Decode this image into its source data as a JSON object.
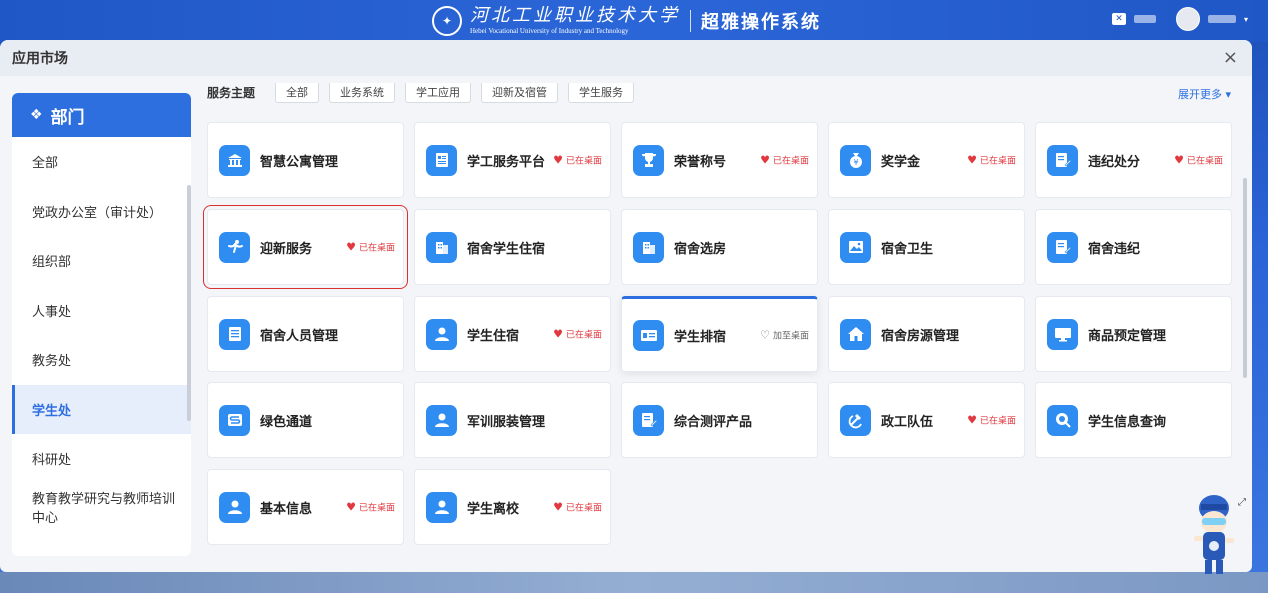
{
  "header": {
    "university_cn": "河北工业职业技术大学",
    "university_en": "Hebei Vocational University of Industry and Technology",
    "system_name": "超雅操作系统"
  },
  "modal": {
    "title": "应用市场",
    "close_symbol": "×"
  },
  "sidebar": {
    "title": "部门",
    "items": [
      {
        "label": "全部"
      },
      {
        "label": "党政办公室（审计处）"
      },
      {
        "label": "组织部"
      },
      {
        "label": "人事处"
      },
      {
        "label": "教务处"
      },
      {
        "label": "学生处",
        "active": true
      },
      {
        "label": "科研处"
      },
      {
        "label": "教育教学研究与教师培训中心"
      }
    ]
  },
  "filter": {
    "label": "服务主题",
    "chips": [
      "全部",
      "业务系统",
      "学工应用",
      "迎新及宿管",
      "学生服务"
    ],
    "expand_label": "展开更多"
  },
  "apps": [
    {
      "name": "智慧公寓管理",
      "status": "",
      "icon": "bank-icon"
    },
    {
      "name": "学工服务平台",
      "status": "已在桌面",
      "icon": "document-icon"
    },
    {
      "name": "荣誉称号",
      "status": "已在桌面",
      "icon": "trophy-icon"
    },
    {
      "name": "奖学金",
      "status": "已在桌面",
      "icon": "money-bag-icon"
    },
    {
      "name": "违纪处分",
      "status": "已在桌面",
      "icon": "edit-document-icon"
    },
    {
      "name": "迎新服务",
      "status": "已在桌面",
      "icon": "welcome-icon"
    },
    {
      "name": "宿舍学生住宿",
      "status": "",
      "icon": "building-icon"
    },
    {
      "name": "宿舍选房",
      "status": "",
      "icon": "building-icon"
    },
    {
      "name": "宿舍卫生",
      "status": "",
      "icon": "image-icon"
    },
    {
      "name": "宿舍违纪",
      "status": "",
      "icon": "edit-document-icon"
    },
    {
      "name": "宿舍人员管理",
      "status": "",
      "icon": "list-icon"
    },
    {
      "name": "学生住宿",
      "status": "已在桌面",
      "icon": "user-icon"
    },
    {
      "name": "学生排宿",
      "status": "加至桌面",
      "icon": "id-card-icon"
    },
    {
      "name": "宿舍房源管理",
      "status": "",
      "icon": "home-icon"
    },
    {
      "name": "商品预定管理",
      "status": "",
      "icon": "monitor-icon"
    },
    {
      "name": "绿色通道",
      "status": "",
      "icon": "s-road-icon"
    },
    {
      "name": "军训服装管理",
      "status": "",
      "icon": "user-icon"
    },
    {
      "name": "综合测评产品",
      "status": "",
      "icon": "edit-document-icon"
    },
    {
      "name": "政工队伍",
      "status": "已在桌面",
      "icon": "hammer-sickle-icon"
    },
    {
      "name": "学生信息查询",
      "status": "",
      "icon": "search-icon"
    },
    {
      "name": "基本信息",
      "status": "已在桌面",
      "icon": "user-icon"
    },
    {
      "name": "学生离校",
      "status": "已在桌面",
      "icon": "user-icon"
    }
  ],
  "colors": {
    "accent": "#2e6fe0",
    "icon_bg": "#2f8cf0",
    "on_desktop": "#e0383e",
    "highlight_box": "#d9322e"
  }
}
